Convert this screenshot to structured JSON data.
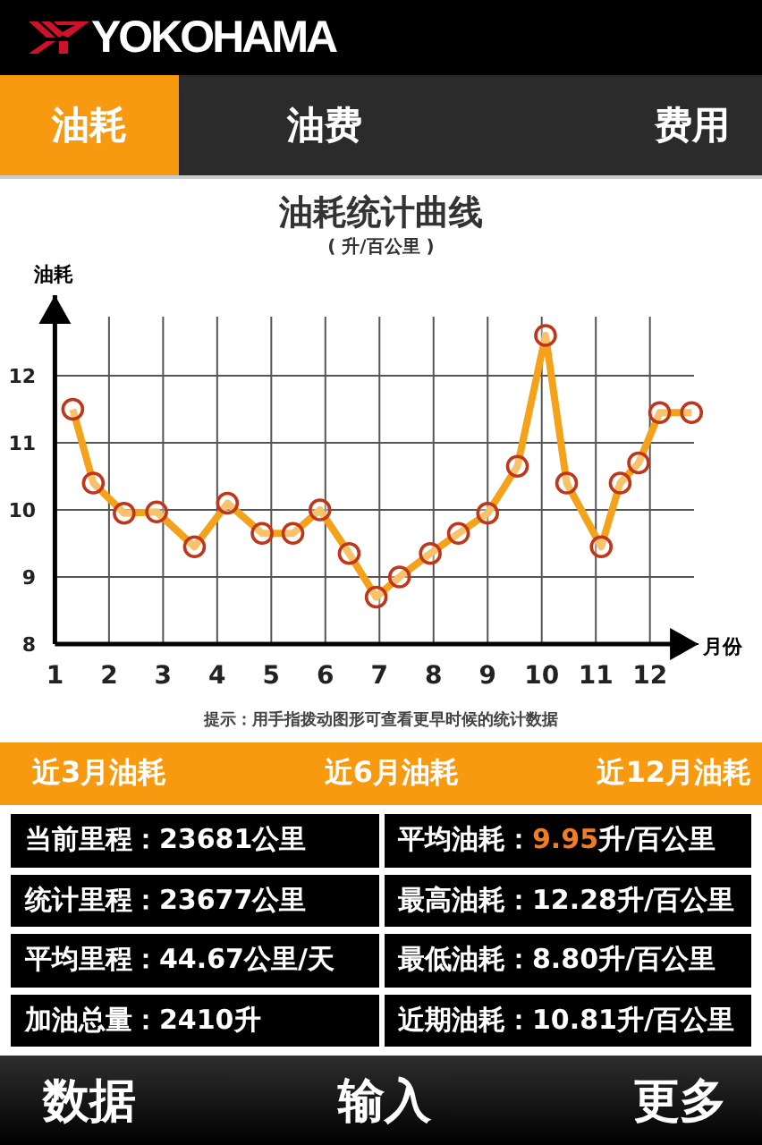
{
  "header": {
    "logo_text": "YOKOHAMA"
  },
  "tabs": [
    {
      "label": "油耗",
      "selected": true
    },
    {
      "label": "油费",
      "selected": false
    },
    {
      "label": "费用",
      "selected": false
    }
  ],
  "chart": {
    "subtitle": "( 升/百公里 )",
    "hint": "提示：用手指拨动图形可查看更早时候的统计数据",
    "chart_data": {
      "type": "line",
      "title": "油耗统计曲线",
      "xlabel": "月份",
      "ylabel": "油耗",
      "x": [
        1.33,
        1.71,
        2.28,
        2.88,
        3.58,
        4.19,
        4.83,
        5.4,
        5.9,
        6.44,
        6.94,
        7.37,
        7.94,
        8.46,
        9.0,
        9.55,
        10.07,
        10.46,
        11.1,
        11.45,
        11.79,
        12.18,
        12.77
      ],
      "series": [
        {
          "color": "#f5a21b",
          "marker": "circle",
          "values": [
            11.5,
            10.4,
            9.95,
            9.97,
            9.45,
            10.1,
            9.65,
            9.65,
            10.0,
            9.35,
            8.7,
            9.0,
            9.35,
            9.65,
            9.95,
            10.65,
            12.6,
            10.4,
            9.45,
            10.4,
            10.7,
            11.45,
            11.45
          ]
        }
      ],
      "xlim": [
        1,
        12.9
      ],
      "ylim": [
        8,
        13.2
      ],
      "grid": true,
      "xticks": [
        1,
        2,
        3,
        4,
        5,
        6,
        7,
        8,
        9,
        10,
        11,
        12
      ],
      "yticks": [
        8,
        9,
        10,
        11,
        12
      ]
    }
  },
  "periods": [
    {
      "label": "近3月油耗"
    },
    {
      "label": "近6月油耗"
    },
    {
      "label": "近12月油耗"
    }
  ],
  "stats": [
    {
      "label": "当前里程：",
      "value": "23681",
      "unit": "公里",
      "highlight": false
    },
    {
      "label": "平均油耗：",
      "value": "9.95",
      "unit": "升/百公里",
      "highlight": true
    },
    {
      "label": "统计里程：",
      "value": "23677",
      "unit": "公里",
      "highlight": false
    },
    {
      "label": "最高油耗：",
      "value": "12.28",
      "unit": "升/百公里",
      "highlight": false
    },
    {
      "label": "平均里程：",
      "value": "44.67",
      "unit": "公里/天",
      "highlight": false
    },
    {
      "label": "最低油耗：",
      "value": "8.80",
      "unit": "升/百公里",
      "highlight": false
    },
    {
      "label": "加油总量：",
      "value": "2410",
      "unit": "升",
      "highlight": false
    },
    {
      "label": "近期油耗：",
      "value": "10.81",
      "unit": "升/百公里",
      "highlight": false
    }
  ],
  "bottom_nav": [
    {
      "label": "数据"
    },
    {
      "label": "输入"
    },
    {
      "label": "更多"
    }
  ]
}
